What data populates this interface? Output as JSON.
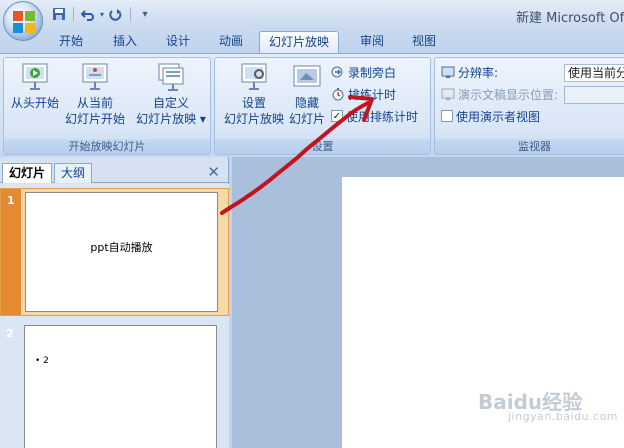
{
  "titlebar": {
    "window_title": "新建 Microsoft Of",
    "qat_icons": [
      "save-icon",
      "undo-icon",
      "redo-icon",
      "customize-icon"
    ]
  },
  "tabs": [
    {
      "label": "开始"
    },
    {
      "label": "插入"
    },
    {
      "label": "设计"
    },
    {
      "label": "动画"
    },
    {
      "label": "幻灯片放映",
      "active": true
    },
    {
      "label": "审阅"
    },
    {
      "label": "视图"
    }
  ],
  "ribbon": {
    "start_group": {
      "label": "开始放映幻灯片",
      "from_beginning": "从头开始",
      "from_current_l1": "从当前",
      "from_current_l2": "幻灯片开始",
      "custom_l1": "自定义",
      "custom_l2": "幻灯片放映 ▾"
    },
    "setup_group": {
      "label": "设置",
      "setup_l1": "设置",
      "setup_l2": "幻灯片放映",
      "hide_l1": "隐藏",
      "hide_l2": "幻灯片",
      "record_narration": "录制旁白",
      "rehearse_timings": "排练计时",
      "use_rehearsed_timings": "使用排练计时",
      "use_rehearsed_checked": true
    },
    "monitor_group": {
      "label": "监视器",
      "resolution_label": "分辨率:",
      "resolution_value": "使用当前分",
      "show_on_label": "演示文稿显示位置:",
      "presenter_view": "使用演示者视图",
      "presenter_checked": false
    }
  },
  "left_pane": {
    "tab_slides": "幻灯片",
    "tab_outline": "大纲",
    "close": "✕",
    "slides": [
      {
        "number": "1",
        "text": "ppt自动播放"
      },
      {
        "number": "2",
        "text": "• 2"
      }
    ]
  },
  "watermark": {
    "brand": "Baidu经验",
    "url": "jingyan.baidu.com"
  },
  "colors": {
    "accent": "#15428b",
    "annotation_arrow": "#c0141e",
    "selection": "#e48a32"
  }
}
